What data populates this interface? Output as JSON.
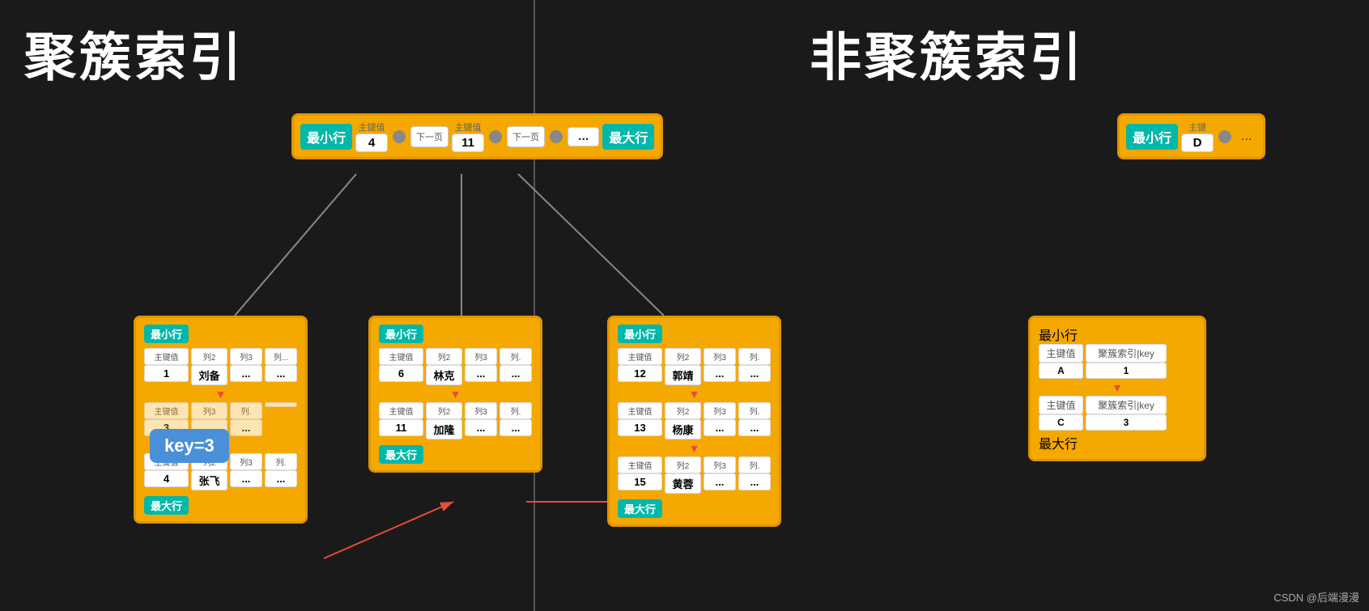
{
  "left_title": "聚簇索引",
  "right_title": "非聚簇索引",
  "root_node": {
    "min_label": "最小行",
    "key1_header": "主键值",
    "key1_value": "4",
    "next1": "下一页",
    "key2_header": "主键值",
    "key2_value": "11",
    "next2": "下一页",
    "dots": "...",
    "max_label": "最大行"
  },
  "leaf1": {
    "min_label": "最小行",
    "max_label": "最大行",
    "rows": [
      {
        "key_header": "主键值",
        "key_val": "1",
        "col2_h": "列2",
        "col2_v": "刘备",
        "col3_h": "列3",
        "col3_v": "...",
        "col4_h": "列...",
        "col4_v": "..."
      },
      {
        "key_header": "主键值",
        "key_val": "...",
        "col2_h": "列3",
        "col2_v": "...",
        "col3_h": "列.",
        "col3_v": "...",
        "col4_h": "",
        "col4_v": ""
      },
      {
        "key_header": "主键值",
        "key_val": "4",
        "col2_h": "列2",
        "col2_v": "张飞",
        "col3_h": "列3",
        "col3_v": "...",
        "col4_h": "列.",
        "col4_v": "..."
      }
    ]
  },
  "leaf2": {
    "min_label": "最小行",
    "max_label": "最大行",
    "rows": [
      {
        "key_header": "主键值",
        "key_val": "6",
        "col2_h": "列2",
        "col2_v": "林克",
        "col3_h": "列3",
        "col3_v": "...",
        "col4_h": "列.",
        "col4_v": "..."
      },
      {
        "key_header": "主键值",
        "key_val": "11",
        "col2_h": "列2",
        "col2_v": "加隆",
        "col3_h": "列3",
        "col3_v": "...",
        "col4_h": "列.",
        "col4_v": "..."
      }
    ]
  },
  "leaf3": {
    "min_label": "最小行",
    "max_label": "最大行",
    "rows": [
      {
        "key_header": "主键值",
        "key_val": "12",
        "col2_h": "列2",
        "col2_v": "郭靖",
        "col3_h": "列3",
        "col3_v": "...",
        "col4_h": "列.",
        "col4_v": "..."
      },
      {
        "key_header": "主键值",
        "key_val": "13",
        "col2_h": "列2",
        "col2_v": "杨康",
        "col3_h": "列3",
        "col3_v": "...",
        "col4_h": "列.",
        "col4_v": "..."
      },
      {
        "key_header": "主键值",
        "key_val": "15",
        "col2_h": "列2",
        "col2_v": "黄蓉",
        "col3_h": "列3",
        "col3_v": "...",
        "col4_h": "列.",
        "col4_v": "..."
      }
    ]
  },
  "key_box": "key=3",
  "nc_root": {
    "min_label": "最小行",
    "key1_header": "主键",
    "key1_value": "D"
  },
  "nc_leaf1": {
    "min_label": "最小行",
    "max_label": "最大行",
    "rows": [
      {
        "key_h": "主键值",
        "key_v": "A",
        "idx_h": "聚簇索引|key",
        "idx_v": "1"
      },
      {
        "key_h": "主键值",
        "key_v": "C",
        "idx_h": "聚簇索引|key",
        "idx_v": "3"
      }
    ]
  },
  "watermark": "CSDN @后端漫漫"
}
